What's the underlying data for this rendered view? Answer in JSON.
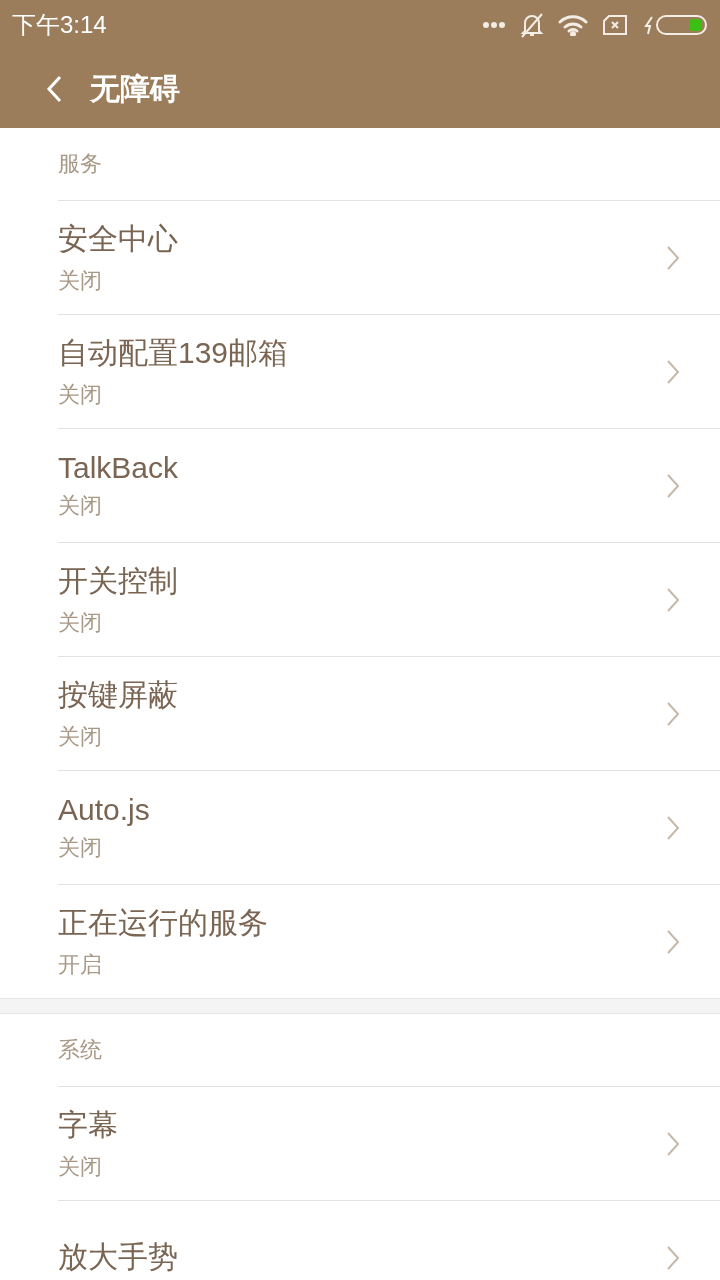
{
  "status_bar": {
    "time": "下午3:14"
  },
  "toolbar": {
    "title": "无障碍"
  },
  "sections": [
    {
      "header": "服务",
      "items": [
        {
          "title": "安全中心",
          "summary": "关闭"
        },
        {
          "title": "自动配置139邮箱",
          "summary": "关闭"
        },
        {
          "title": "TalkBack",
          "summary": "关闭"
        },
        {
          "title": "开关控制",
          "summary": "关闭"
        },
        {
          "title": "按键屏蔽",
          "summary": "关闭"
        },
        {
          "title": "Auto.js",
          "summary": "关闭"
        },
        {
          "title": "正在运行的服务",
          "summary": "开启"
        }
      ]
    },
    {
      "header": "系统",
      "items": [
        {
          "title": "字幕",
          "summary": "关闭"
        },
        {
          "title": "放大手势"
        }
      ]
    }
  ]
}
